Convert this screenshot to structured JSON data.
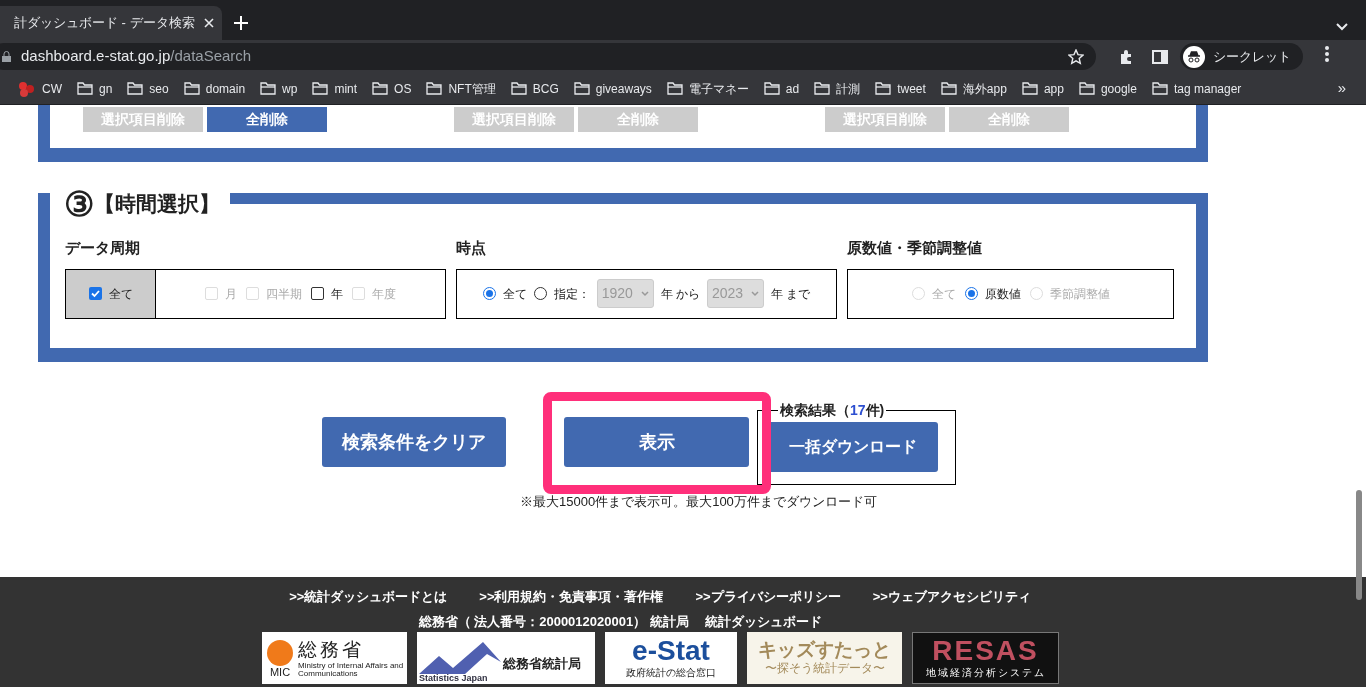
{
  "browser": {
    "tab_title": "計ダッシュボード - データ検索",
    "url_host": "dashboard.e-stat.go.jp",
    "url_path": "/dataSearch",
    "profile": "シークレット",
    "bookmarks": [
      {
        "label": "CW",
        "kind": "app"
      },
      {
        "label": "gn",
        "kind": "folder"
      },
      {
        "label": "seo",
        "kind": "folder"
      },
      {
        "label": "domain",
        "kind": "folder"
      },
      {
        "label": "wp",
        "kind": "folder"
      },
      {
        "label": "mint",
        "kind": "folder"
      },
      {
        "label": "OS",
        "kind": "folder"
      },
      {
        "label": "NFT管理",
        "kind": "folder"
      },
      {
        "label": "BCG",
        "kind": "folder"
      },
      {
        "label": "giveaways",
        "kind": "folder"
      },
      {
        "label": "電子マネー",
        "kind": "folder"
      },
      {
        "label": "ad",
        "kind": "folder"
      },
      {
        "label": "計測",
        "kind": "folder"
      },
      {
        "label": "tweet",
        "kind": "folder"
      },
      {
        "label": "海外app",
        "kind": "folder"
      },
      {
        "label": "app",
        "kind": "folder"
      },
      {
        "label": "google",
        "kind": "folder"
      },
      {
        "label": "tag manager",
        "kind": "folder"
      }
    ],
    "more": "»"
  },
  "section2_buttons": [
    [
      {
        "label": "選択項目削除",
        "disabled": true
      },
      {
        "label": "全削除",
        "disabled": false
      }
    ],
    [
      {
        "label": "選択項目削除",
        "disabled": true
      },
      {
        "label": "全削除",
        "disabled": true
      }
    ],
    [
      {
        "label": "選択項目削除",
        "disabled": true
      },
      {
        "label": "全削除",
        "disabled": true
      }
    ]
  ],
  "section3": {
    "number": "③",
    "title": "【時間選択】",
    "period": {
      "label": "データ周期",
      "all": {
        "label": "全て",
        "checked": true,
        "disabled": false
      },
      "options": [
        {
          "label": "月",
          "checked": false,
          "disabled": true
        },
        {
          "label": "四半期",
          "checked": false,
          "disabled": true
        },
        {
          "label": "年",
          "checked": false,
          "disabled": false
        },
        {
          "label": "年度",
          "checked": false,
          "disabled": true
        }
      ]
    },
    "time": {
      "label": "時点",
      "options": [
        {
          "label": "全て",
          "selected": true,
          "disabled": false
        },
        {
          "label": "指定：",
          "selected": false,
          "disabled": false
        }
      ],
      "from": {
        "value": "1920",
        "disabled": true
      },
      "from_suffix": "年 から",
      "to": {
        "value": "2023",
        "disabled": true
      },
      "to_suffix": "年 まで"
    },
    "adjust": {
      "label": "原数値・季節調整値",
      "options": [
        {
          "label": "全て",
          "selected": false,
          "disabled": true
        },
        {
          "label": "原数値",
          "selected": true,
          "disabled": false
        },
        {
          "label": "季節調整値",
          "selected": false,
          "disabled": true
        }
      ]
    }
  },
  "actions": {
    "clear": "検索条件をクリア",
    "show": "表示",
    "result_legend": "検索結果（**17**件)",
    "download": "一括ダウンロード",
    "note": "※最大15000件まで表示可。最大100万件までダウンロード可"
  },
  "footer": {
    "links": [
      ">>統計ダッシュボードとは",
      ">>利用規約・免責事項・著作権",
      ">>プライバシーポリシー",
      ">>ウェブアクセシビリティ"
    ],
    "org": "総務省（ 法人番号：2000012020001） 統計局　 統計ダッシュボード",
    "banners": [
      {
        "kind": "mic",
        "texts": [
          "総務省",
          "MIC",
          "Ministry of Internal Affairs and Communications"
        ]
      },
      {
        "kind": "stat",
        "texts": [
          "総務省統計局",
          "Statistics Japan"
        ]
      },
      {
        "kind": "estat",
        "texts": [
          "e-Stat",
          "政府統計の総合窓口"
        ]
      },
      {
        "kind": "kids",
        "texts": [
          "キッズすたっと",
          "〜探そう統計データ〜"
        ]
      },
      {
        "kind": "resas",
        "texts": [
          "RESAS",
          "地域経済分析システム"
        ]
      }
    ]
  }
}
